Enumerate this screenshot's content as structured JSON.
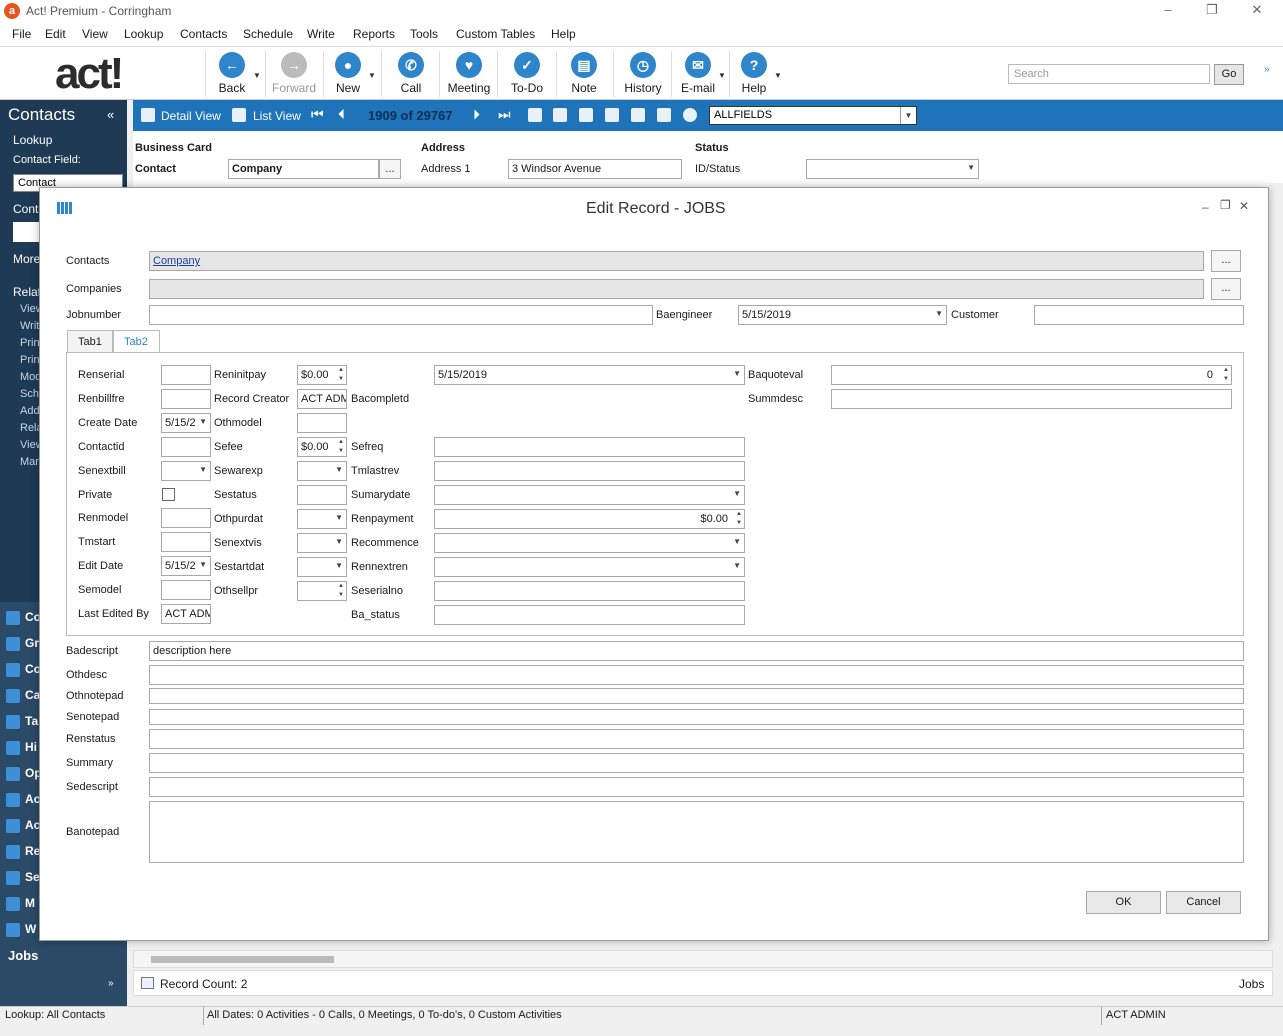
{
  "app": {
    "title": "Act! Premium - Corringham",
    "logo": "a"
  },
  "window_controls": {
    "minimize": "–",
    "restore": "❐",
    "close": "✕"
  },
  "menu": [
    "File",
    "Edit",
    "View",
    "Lookup",
    "Contacts",
    "Schedule",
    "Write",
    "Reports",
    "Tools",
    "Custom Tables",
    "Help"
  ],
  "toolbar": {
    "logo": "act!",
    "buttons": [
      {
        "label": "Back",
        "icon": "back-arrow-icon"
      },
      {
        "label": "Forward",
        "icon": "forward-arrow-icon"
      },
      {
        "label": "New",
        "icon": "new-contact-icon"
      },
      {
        "label": "Call",
        "icon": "phone-icon"
      },
      {
        "label": "Meeting",
        "icon": "handshake-icon"
      },
      {
        "label": "To-Do",
        "icon": "checkmark-icon"
      },
      {
        "label": "Note",
        "icon": "note-icon"
      },
      {
        "label": "History",
        "icon": "clock-icon"
      },
      {
        "label": "E-mail",
        "icon": "envelope-icon"
      },
      {
        "label": "Help",
        "icon": "question-icon"
      }
    ],
    "search_placeholder": "Search",
    "go": "Go"
  },
  "leftnav": {
    "header": "Contacts",
    "lookup": "Lookup",
    "contact_field_label": "Contact Field:",
    "contact_field_value": "Contact",
    "contact_label": "Conta",
    "more": "More",
    "related": "Relat",
    "tasks": [
      "View",
      "Writ",
      "Prin",
      "Prin",
      "Mod",
      "Sch",
      "Add",
      "Rela",
      "View",
      "Man"
    ],
    "modules": [
      "Co",
      "Gr",
      "Co",
      "Ca",
      "Ta",
      "Hi",
      "Op",
      "Ac",
      "Ac",
      "Re",
      "Se",
      "M",
      "W"
    ],
    "jobs": "Jobs"
  },
  "bluebar": {
    "detail_view": "Detail View",
    "list_view": "List View",
    "record_pos": "1909 of 29767",
    "allfields": "ALLFIELDS"
  },
  "bizcard": {
    "business_card": "Business Card",
    "contact_label": "Contact",
    "contact_value": "Company",
    "address": "Address",
    "address1_label": "Address 1",
    "address1_value": "3 Windsor Avenue",
    "status": "Status",
    "idstatus_label": "ID/Status"
  },
  "dialog": {
    "title": "Edit Record - JOBS",
    "contacts_label": "Contacts",
    "contacts_value": "Company",
    "companies_label": "Companies",
    "jobnumber_label": "Jobnumber",
    "baengineer_label": "Baengineer",
    "baengineer_value": "5/15/2019",
    "customer_label": "Customer",
    "tabs": [
      "Tab1",
      "Tab2"
    ],
    "col1": [
      {
        "label": "Renserial",
        "value": ""
      },
      {
        "label": "Renbillfre",
        "value": ""
      },
      {
        "label": "Create Date",
        "value": "5/15/2"
      },
      {
        "label": "Contactid",
        "value": ""
      },
      {
        "label": "Senextbill",
        "value": ""
      },
      {
        "label": "Private",
        "value": ""
      },
      {
        "label": "Renmodel",
        "value": ""
      },
      {
        "label": "Tmstart",
        "value": ""
      },
      {
        "label": "Edit Date",
        "value": "5/15/2"
      },
      {
        "label": "Semodel",
        "value": ""
      },
      {
        "label": "Last Edited By",
        "value": "ACT ADM"
      }
    ],
    "col2": [
      {
        "label": "Reninitpay",
        "value": "$0.00"
      },
      {
        "label": "Record Creator",
        "value": "ACT ADM"
      },
      {
        "label": "Othmodel",
        "value": ""
      },
      {
        "label": "Sefee",
        "value": "$0.00"
      },
      {
        "label": "Sewarexp",
        "value": ""
      },
      {
        "label": "Sestatus",
        "value": ""
      },
      {
        "label": "Othpurdat",
        "value": ""
      },
      {
        "label": "Senextvis",
        "value": ""
      },
      {
        "label": "Sestartdat",
        "value": ""
      },
      {
        "label": "Othsellpr",
        "value": ""
      }
    ],
    "col3": [
      {
        "label": "",
        "value": "5/15/2019"
      },
      {
        "label": "Bacompletd",
        "value": ""
      },
      {
        "label": "Sefreq",
        "value": ""
      },
      {
        "label": "Tmlastrev",
        "value": ""
      },
      {
        "label": "Sumarydate",
        "value": ""
      },
      {
        "label": "Renpayment",
        "value": "$0.00"
      },
      {
        "label": "Recommence",
        "value": ""
      },
      {
        "label": "Rennextren",
        "value": ""
      },
      {
        "label": "Seserialno",
        "value": ""
      },
      {
        "label": "Ba_status",
        "value": ""
      }
    ],
    "col4": [
      {
        "label": "Baquoteval",
        "value": "0"
      },
      {
        "label": "Summdesc",
        "value": ""
      }
    ],
    "wide": [
      {
        "label": "Badescript",
        "value": "description  here"
      },
      {
        "label": "Othdesc",
        "value": ""
      },
      {
        "label": "Othnotepad",
        "value": ""
      },
      {
        "label": "Senotepad",
        "value": ""
      },
      {
        "label": "Renstatus",
        "value": ""
      },
      {
        "label": "Summary",
        "value": ""
      },
      {
        "label": "Sedescript",
        "value": ""
      },
      {
        "label": "Banotepad",
        "value": ""
      }
    ],
    "ok": "OK",
    "cancel": "Cancel"
  },
  "footer": {
    "record_count": "Record Count: 2",
    "jobs": "Jobs"
  },
  "status": {
    "lookup": "Lookup: All Contacts",
    "dates": "All Dates: 0 Activities - 0 Calls, 0 Meetings, 0 To-do's, 0 Custom Activities",
    "user": "ACT ADMIN"
  }
}
